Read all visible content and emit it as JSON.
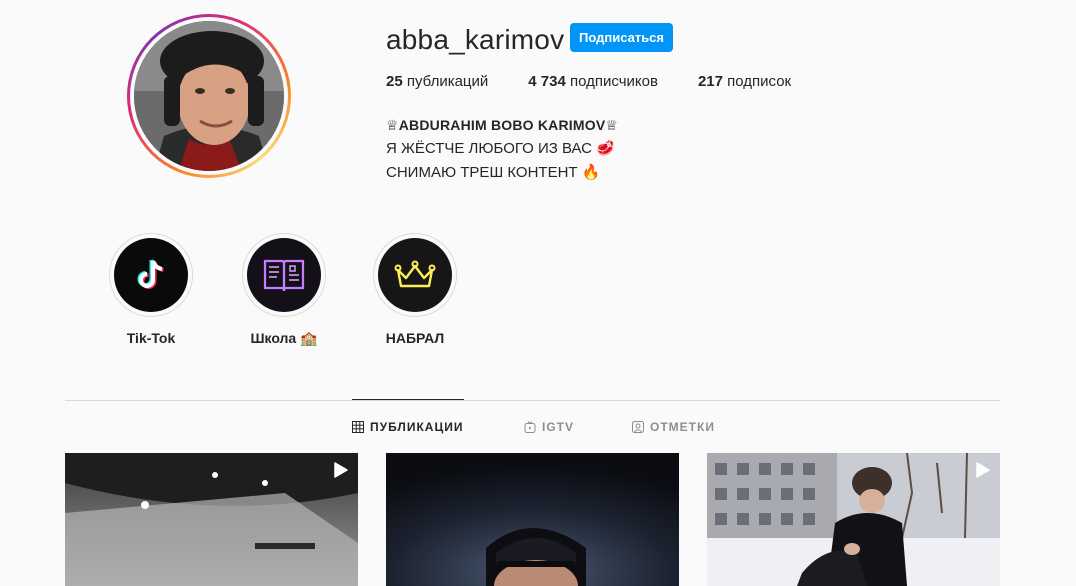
{
  "profile": {
    "username": "abba_karimov",
    "follow_label": "Подписаться"
  },
  "stats": {
    "posts_count": "25",
    "posts_label": " публикаций",
    "followers_count": "4 734",
    "followers_label": " подписчиков",
    "following_count": "217",
    "following_label": " подписок"
  },
  "bio": {
    "name": "♕ABDURAHIM BOBO KARIMOV♕",
    "line1": "Я ЖЁСТЧЕ ЛЮБОГО ИЗ ВАС 🥩",
    "line2": "СНИМАЮ ТРЕШ КОНТЕНТ 🔥"
  },
  "highlights": [
    {
      "label": "Tik-Tok",
      "icon": "tiktok-icon"
    },
    {
      "label": "Школа 🏫",
      "icon": "book-icon"
    },
    {
      "label": "НАБРАЛ",
      "icon": "crown-icon"
    }
  ],
  "tabs": [
    {
      "label": "ПУБЛИКАЦИИ",
      "icon": "grid-icon",
      "active": true
    },
    {
      "label": "IGTV",
      "icon": "igtv-icon",
      "active": false
    },
    {
      "label": "ОТМЕТКИ",
      "icon": "tagged-icon",
      "active": false
    }
  ],
  "posts": [
    {
      "type": "video",
      "icon": "play-icon"
    },
    {
      "type": "photo"
    },
    {
      "type": "video",
      "icon": "play-icon"
    }
  ],
  "colors": {
    "accent": "#0095f6",
    "text": "#262626",
    "muted": "#8e8e8e",
    "border": "#dbdbdb",
    "background": "#fafafa"
  }
}
